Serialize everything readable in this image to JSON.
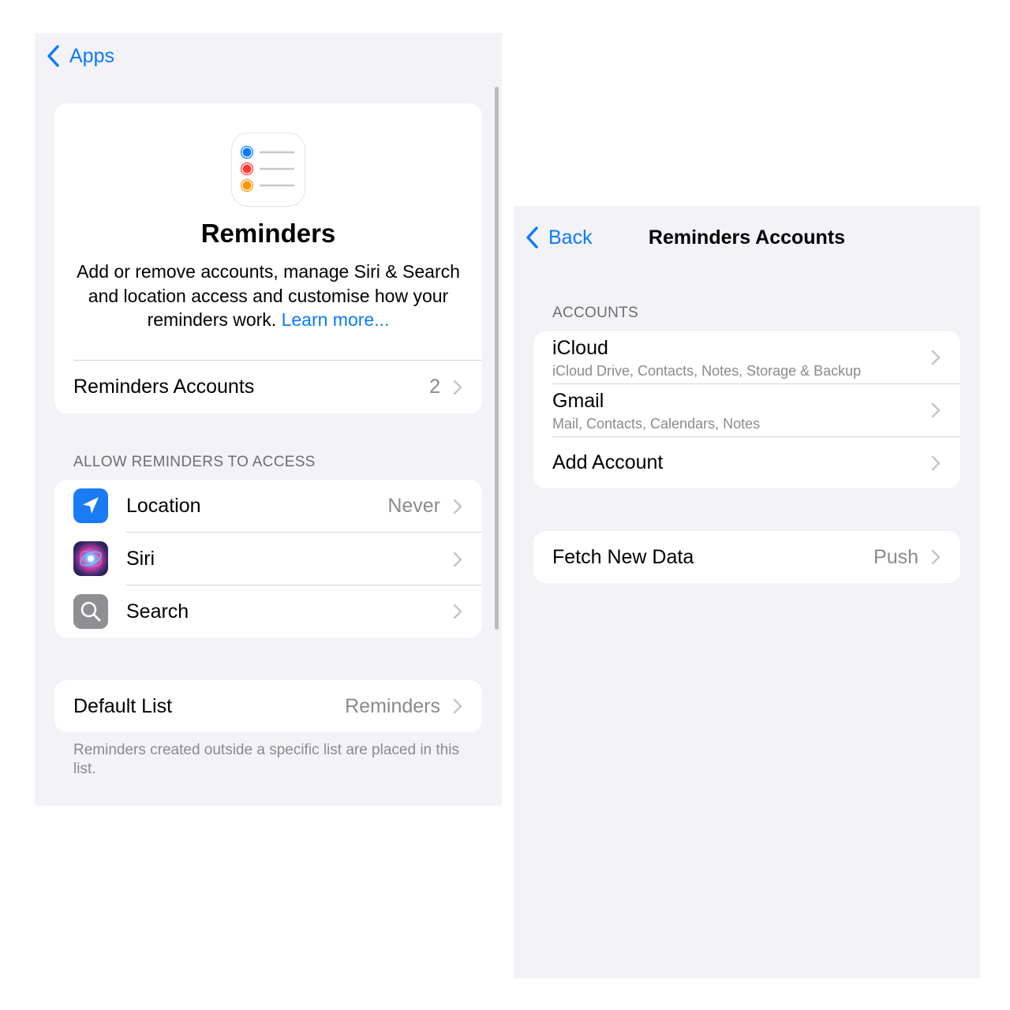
{
  "left": {
    "nav": {
      "back_label": "Apps"
    },
    "header": {
      "icon": "reminders-app-icon",
      "title": "Reminders",
      "description": "Add or remove accounts, manage Siri & Search and location access and customise how your reminders work.",
      "learn_more": "Learn more..."
    },
    "accounts_row": {
      "label": "Reminders Accounts",
      "value": "2"
    },
    "access_section": {
      "header": "ALLOW REMINDERS TO ACCESS",
      "items": [
        {
          "label": "Location",
          "value": "Never",
          "icon": "location-arrow-icon"
        },
        {
          "label": "Siri",
          "value": "",
          "icon": "siri-icon"
        },
        {
          "label": "Search",
          "value": "",
          "icon": "search-icon"
        }
      ]
    },
    "default_list": {
      "label": "Default List",
      "value": "Reminders",
      "footnote": "Reminders created outside a specific list are placed in this list."
    }
  },
  "right": {
    "nav": {
      "back_label": "Back",
      "title": "Reminders Accounts"
    },
    "accounts_section": {
      "header": "ACCOUNTS",
      "items": [
        {
          "label": "iCloud",
          "detail": "iCloud Drive, Contacts, Notes, Storage & Backup"
        },
        {
          "label": "Gmail",
          "detail": "Mail, Contacts, Calendars, Notes"
        },
        {
          "label": "Add Account",
          "detail": ""
        }
      ]
    },
    "fetch_row": {
      "label": "Fetch New Data",
      "value": "Push"
    }
  },
  "colors": {
    "accent": "#0a7aff",
    "background": "#f2f2f7",
    "card": "#ffffff",
    "secondary_text": "#8a8a8e",
    "location_icon_bg": "#1a7bf4",
    "search_icon_bg": "#8e8e93"
  }
}
